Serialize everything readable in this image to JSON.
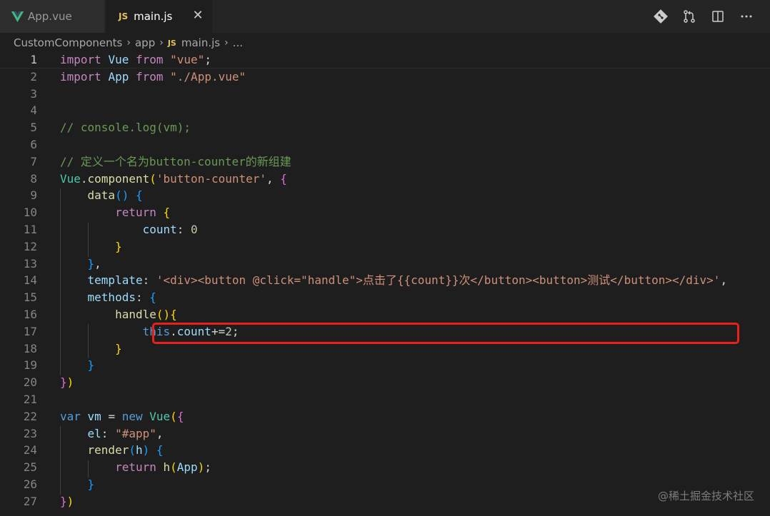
{
  "tabs": [
    {
      "label": "App.vue",
      "icon": "vue-icon",
      "active": false
    },
    {
      "label": "main.js",
      "icon": "js-icon",
      "active": true
    }
  ],
  "tab_close": "✕",
  "breadcrumb": {
    "items": [
      "CustomComponents",
      "app",
      "main.js",
      "..."
    ],
    "js_badge": "JS"
  },
  "editor_actions": [
    "git-compare-icon",
    "pull-request-icon",
    "split-editor-icon",
    "more-actions-icon"
  ],
  "code": {
    "language": "javascript",
    "current_line": 1,
    "highlighted_line": 14,
    "line_numbers": [
      "1",
      "2",
      "3",
      "4",
      "5",
      "6",
      "7",
      "8",
      "9",
      "10",
      "11",
      "12",
      "13",
      "14",
      "15",
      "16",
      "17",
      "18",
      "19",
      "20",
      "21",
      "22",
      "23",
      "24",
      "25",
      "26",
      "27"
    ],
    "lines": [
      [
        [
          "kw",
          "import"
        ],
        [
          "p",
          " "
        ],
        [
          "var",
          "Vue"
        ],
        [
          "p",
          " "
        ],
        [
          "kw",
          "from"
        ],
        [
          "p",
          " "
        ],
        [
          "str",
          "\"vue\""
        ],
        [
          "p",
          ";"
        ]
      ],
      [
        [
          "kw",
          "import"
        ],
        [
          "p",
          " "
        ],
        [
          "var",
          "App"
        ],
        [
          "p",
          " "
        ],
        [
          "kw",
          "from"
        ],
        [
          "p",
          " "
        ],
        [
          "str",
          "\"./App.vue\""
        ]
      ],
      [],
      [],
      [
        [
          "com",
          "// console.log(vm);"
        ]
      ],
      [],
      [
        [
          "com",
          "// 定义一个名为button-counter的新组建"
        ]
      ],
      [
        [
          "cls",
          "Vue"
        ],
        [
          "p",
          "."
        ],
        [
          "fn",
          "component"
        ],
        [
          "b1",
          "("
        ],
        [
          "str",
          "'button-counter'"
        ],
        [
          "p",
          ", "
        ],
        [
          "b2",
          "{"
        ]
      ],
      [
        [
          "p",
          "    "
        ],
        [
          "fn",
          "data"
        ],
        [
          "b3",
          "()"
        ],
        [
          "p",
          " "
        ],
        [
          "b3",
          "{"
        ]
      ],
      [
        [
          "p",
          "        "
        ],
        [
          "kw",
          "return"
        ],
        [
          "p",
          " "
        ],
        [
          "b1",
          "{"
        ]
      ],
      [
        [
          "p",
          "            "
        ],
        [
          "var",
          "count"
        ],
        [
          "p",
          ": "
        ],
        [
          "num",
          "0"
        ]
      ],
      [
        [
          "p",
          "        "
        ],
        [
          "b1",
          "}"
        ]
      ],
      [
        [
          "p",
          "    "
        ],
        [
          "b3",
          "}"
        ],
        [
          "p",
          ","
        ]
      ],
      [
        [
          "p",
          "    "
        ],
        [
          "var",
          "template"
        ],
        [
          "p",
          ": "
        ],
        [
          "str",
          "'<div><button @click=\"handle\">点击了{{count}}次</button><button>测试</button></div>'"
        ],
        [
          "p",
          ","
        ]
      ],
      [
        [
          "p",
          "    "
        ],
        [
          "var",
          "methods"
        ],
        [
          "p",
          ": "
        ],
        [
          "b3",
          "{"
        ]
      ],
      [
        [
          "p",
          "        "
        ],
        [
          "fn",
          "handle"
        ],
        [
          "b1",
          "()"
        ],
        [
          "b1",
          "{"
        ]
      ],
      [
        [
          "p",
          "            "
        ],
        [
          "kwb",
          "this"
        ],
        [
          "p",
          "."
        ],
        [
          "var",
          "count"
        ],
        [
          "p",
          "+="
        ],
        [
          "num",
          "2"
        ],
        [
          "p",
          ";"
        ]
      ],
      [
        [
          "p",
          "        "
        ],
        [
          "b1",
          "}"
        ]
      ],
      [
        [
          "p",
          "    "
        ],
        [
          "b3",
          "}"
        ]
      ],
      [
        [
          "b2",
          "}"
        ],
        [
          "b1",
          ")"
        ]
      ],
      [],
      [
        [
          "kwb",
          "var"
        ],
        [
          "p",
          " "
        ],
        [
          "var",
          "vm"
        ],
        [
          "p",
          " = "
        ],
        [
          "kwb",
          "new"
        ],
        [
          "p",
          " "
        ],
        [
          "cls",
          "Vue"
        ],
        [
          "b1",
          "("
        ],
        [
          "b2",
          "{"
        ]
      ],
      [
        [
          "p",
          "    "
        ],
        [
          "var",
          "el"
        ],
        [
          "p",
          ": "
        ],
        [
          "str",
          "\"#app\""
        ],
        [
          "p",
          ","
        ]
      ],
      [
        [
          "p",
          "    "
        ],
        [
          "fn",
          "render"
        ],
        [
          "b3",
          "("
        ],
        [
          "var",
          "h"
        ],
        [
          "b3",
          ")"
        ],
        [
          "p",
          " "
        ],
        [
          "b3",
          "{"
        ]
      ],
      [
        [
          "p",
          "        "
        ],
        [
          "kw",
          "return"
        ],
        [
          "p",
          " "
        ],
        [
          "fn",
          "h"
        ],
        [
          "b1",
          "("
        ],
        [
          "var",
          "App"
        ],
        [
          "b1",
          ")"
        ],
        [
          "p",
          ";"
        ]
      ],
      [
        [
          "p",
          "    "
        ],
        [
          "b3",
          "}"
        ]
      ],
      [
        [
          "b2",
          "}"
        ],
        [
          "b1",
          ")"
        ]
      ]
    ]
  },
  "watermark": "@稀土掘金技术社区",
  "colors": {
    "editor_bg": "#1e1e1e",
    "tabbar_bg": "#252526",
    "highlight_border": "#e8211c",
    "js_badge": "#e5c25b",
    "vue_logo": "#41b883"
  }
}
